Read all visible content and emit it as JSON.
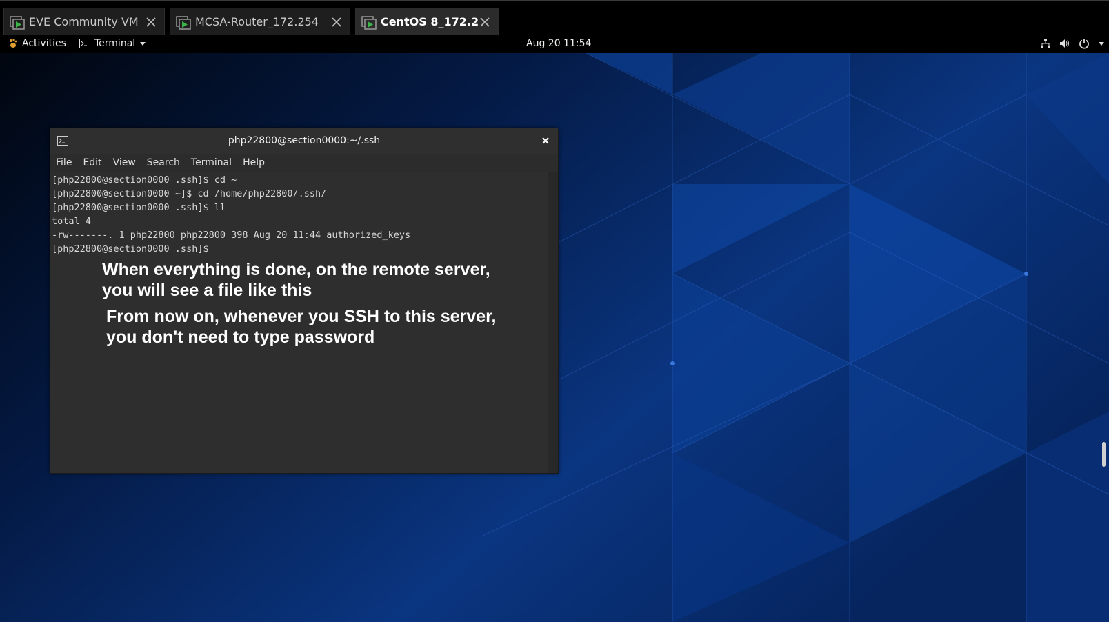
{
  "tabs": [
    {
      "label": "EVE Community VM",
      "active": false
    },
    {
      "label": "MCSA-Router_172.254",
      "active": false
    },
    {
      "label": "CentOS 8_172.2",
      "active": true
    }
  ],
  "topbar": {
    "activities_label": "Activities",
    "app_menu_label": "Terminal",
    "clock": "Aug 20  11:54",
    "tray_icons": [
      "network-icon",
      "volume-icon",
      "power-icon",
      "chevron-down-icon"
    ]
  },
  "terminal": {
    "title": "php22800@section0000:~/.ssh",
    "menu": [
      "File",
      "Edit",
      "View",
      "Search",
      "Terminal",
      "Help"
    ],
    "lines": [
      "[php22800@section0000 .ssh]$ cd ~",
      "[php22800@section0000 ~]$ cd /home/php22800/.ssh/",
      "[php22800@section0000 .ssh]$ ll",
      "total 4",
      "-rw-------. 1 php22800 php22800 398 Aug 20 11:44 authorized_keys",
      "[php22800@section0000 .ssh]$"
    ]
  },
  "annotations": {
    "note1_line1": "When everything is done, on the remote server,",
    "note1_line2": "you will see a file like this",
    "note2_line1": "From now on, whenever you SSH to this server,",
    "note2_line2": "you don't need to type password"
  },
  "colors": {
    "desktop_blue": "#0a3580",
    "tab_icon_green": "#3cb44a",
    "terminal_bg": "#2e2e2e"
  }
}
